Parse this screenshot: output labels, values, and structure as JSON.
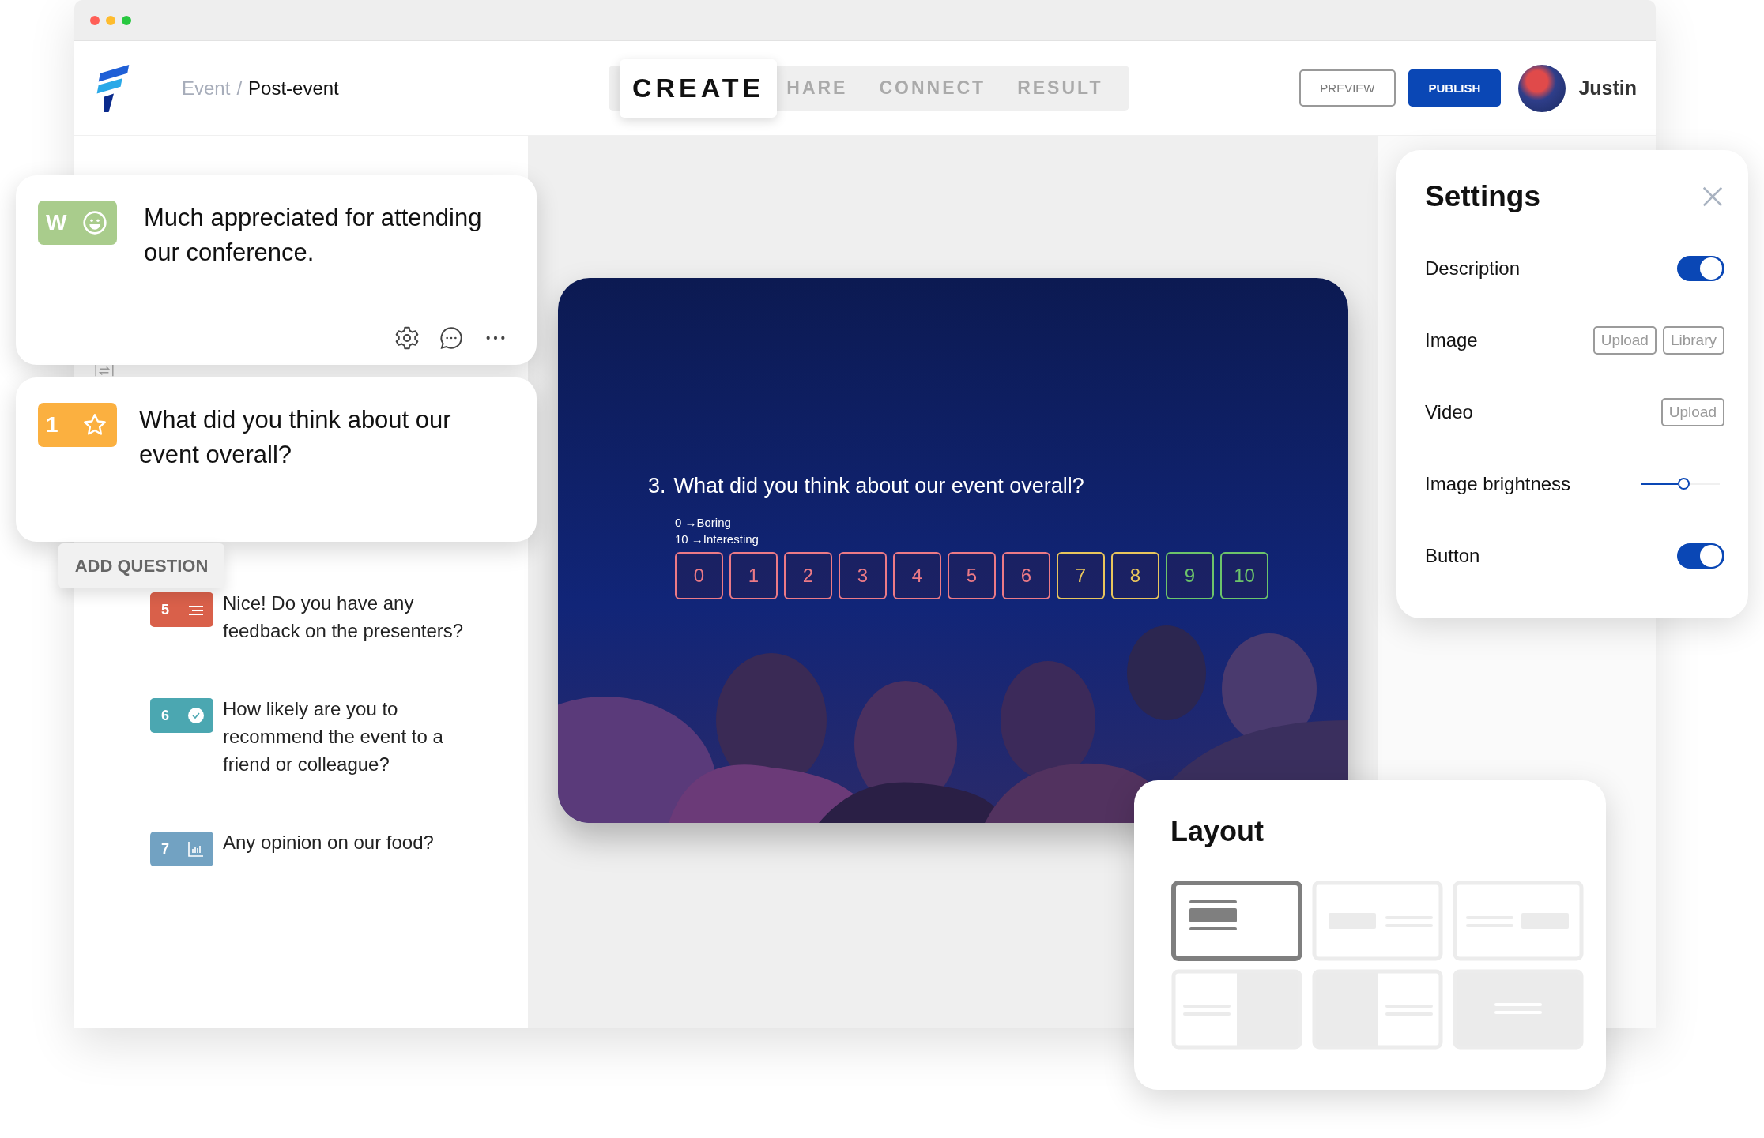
{
  "breadcrumb": {
    "parent": "Event",
    "separator": "/",
    "current": "Post-event"
  },
  "tabs": [
    {
      "label": "CREATE",
      "selected": true
    },
    {
      "label": "HARE",
      "selected": false
    },
    {
      "label": "CONNECT",
      "selected": false
    },
    {
      "label": "RESULT",
      "selected": false
    }
  ],
  "actions": [
    {
      "label": "PREVIEW",
      "kind": "outline"
    },
    {
      "label": "PUBLISH",
      "kind": "primary"
    }
  ],
  "user": {
    "name": "Justin"
  },
  "cards": [
    {
      "badge": "W",
      "kind": "welcome",
      "color": "#a9cc8c",
      "text": "Much appreciated for attending our conference.",
      "tools": true
    },
    {
      "badge": "1",
      "kind": "rating",
      "color": "#fbb040",
      "text": "What did you think about our event overall?",
      "tools": false
    }
  ],
  "add_question": "ADD QUESTION",
  "questions": [
    {
      "number": "5",
      "kind": "text",
      "color": "#d9604a",
      "text": "Nice! Do you have any feedback on the presenters?"
    },
    {
      "number": "6",
      "kind": "choice",
      "color": "#4ba7b1",
      "text": "How likely are you to recommend the event to a friend or colleague?"
    },
    {
      "number": "7",
      "kind": "poll",
      "color": "#72a2c2",
      "text": "Any opinion on our food?"
    }
  ],
  "slide": {
    "number": "3.",
    "question": "What did you think about our event overall?",
    "scale_labels": [
      "0 →Boring",
      "10 →Interesting"
    ],
    "scale": [
      {
        "label": "0",
        "color": "#ec7a86"
      },
      {
        "label": "1",
        "color": "#ec7a86"
      },
      {
        "label": "2",
        "color": "#ec7a86"
      },
      {
        "label": "3",
        "color": "#ec7a86"
      },
      {
        "label": "4",
        "color": "#ec7a86"
      },
      {
        "label": "5",
        "color": "#ec7a86"
      },
      {
        "label": "6",
        "color": "#ec7a86"
      },
      {
        "label": "7",
        "color": "#e8c55c"
      },
      {
        "label": "8",
        "color": "#e8c55c"
      },
      {
        "label": "9",
        "color": "#6cc46a"
      },
      {
        "label": "10",
        "color": "#6cc46a"
      }
    ]
  },
  "settings": {
    "title": "Settings",
    "rows": [
      {
        "kind": "toggle",
        "label": "Description",
        "on": true
      },
      {
        "kind": "buttons",
        "label": "Image",
        "buttons": [
          "Upload",
          "Library"
        ]
      },
      {
        "kind": "buttons",
        "label": "Video",
        "buttons": [
          "Upload"
        ]
      },
      {
        "kind": "slider",
        "label": "Image brightness",
        "level": 0.47
      },
      {
        "kind": "toggle",
        "label": "Button",
        "on": true
      }
    ]
  },
  "layout": {
    "title": "Layout",
    "options": [
      {
        "kind": "image-top",
        "selected": true
      },
      {
        "kind": "image-left",
        "selected": false
      },
      {
        "kind": "image-right",
        "selected": false
      },
      {
        "kind": "half-right",
        "selected": false
      },
      {
        "kind": "half-left",
        "selected": false
      },
      {
        "kind": "full",
        "selected": false
      }
    ]
  }
}
